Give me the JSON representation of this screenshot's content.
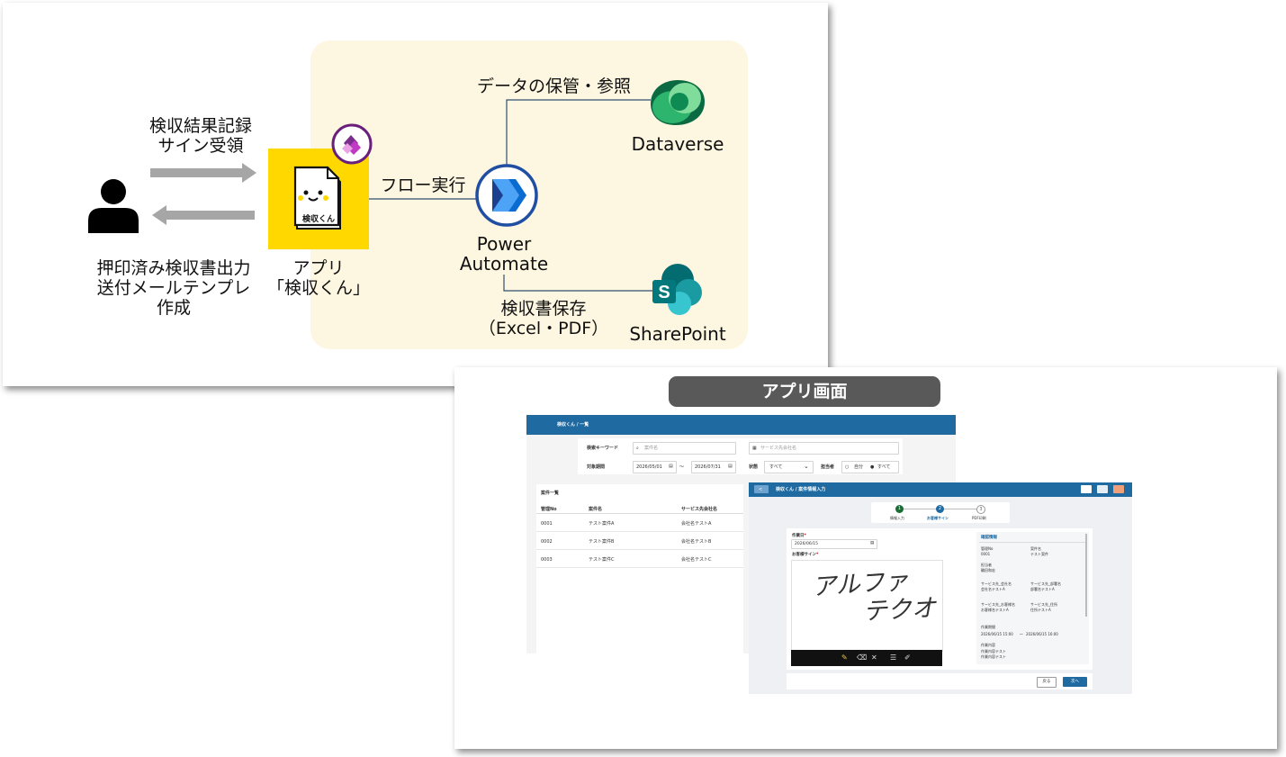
{
  "diagram": {
    "user_labels": {
      "input_line1": "検収結果記録",
      "input_line2": "サイン受領",
      "output_line1": "押印済み検収書出力",
      "output_line2": "送付メールテンプレ",
      "output_line3": "作成"
    },
    "app": {
      "icon_text": "検収くん",
      "label_line1": "アプリ",
      "label_line2": "「検収くん」"
    },
    "flow_label": "フロー実行",
    "power_automate": {
      "line1": "Power",
      "line2": "Automate"
    },
    "dataverse": {
      "label": "Dataverse",
      "edge_label": "データの保管・参照"
    },
    "sharepoint": {
      "label": "SharePoint",
      "edge_line1": "検収書保存",
      "edge_line2": "（Excel・PDF）"
    },
    "colors": {
      "container": "#fdf6e0",
      "arrow": "#a6a6a6",
      "app_bg": "#ffd800",
      "connector": "#2f4f6f"
    }
  },
  "app_screen": {
    "title": "アプリ画面",
    "list_screen": {
      "breadcrumb": "検収くん  /  一覧",
      "search_keyword_label": "検索キーワード",
      "keyword_placeholder": "案件名",
      "company_placeholder": "サービス先会社名",
      "period_label": "対象期間",
      "date_from": "2026/05/01",
      "tilde": "〜",
      "date_to": "2026/07/31",
      "status_label": "状態",
      "status_value": "すべて",
      "owner_label": "担当者",
      "owner_option_self": "自分",
      "owner_option_all": "すべて",
      "table_title": "案件一覧",
      "columns": [
        "管理No",
        "案件名",
        "サービス先会社名"
      ],
      "rows": [
        [
          "0001",
          "テスト案件A",
          "会社名テストA"
        ],
        [
          "0002",
          "テスト案件B",
          "会社名テストB"
        ],
        [
          "0003",
          "テスト案件C",
          "会社名テストC"
        ]
      ]
    },
    "detail_screen": {
      "back_label": "<",
      "breadcrumb": "検収くん  /  案件情報入力",
      "steps": [
        {
          "num": "1",
          "label": "情報入力"
        },
        {
          "num": "2",
          "label": "お客様サイン"
        },
        {
          "num": "3",
          "label": "PDF印刷"
        }
      ],
      "date_label": "作業日",
      "required_mark": "*",
      "date_value": "2026/06/15",
      "sign_label": "お客様サイン",
      "signature_line1": "アルファ",
      "signature_line2": "テクオ",
      "confirm_title": "確認情報",
      "info": [
        {
          "label": "管理No",
          "value": "0001"
        },
        {
          "label": "案件名",
          "value": "テスト案件"
        },
        {
          "label": "担当者",
          "value": "輪田和宏"
        },
        {
          "label": "サービス先_会社名",
          "value": "会社名テストA"
        },
        {
          "label": "サービス先_部署名",
          "value": "部署名テストA"
        },
        {
          "label": "サービス先_お客様名",
          "value": "お客様名テストA"
        },
        {
          "label": "サービス先_住所",
          "value": "住所テストA"
        }
      ],
      "work_time_label": "作業期間",
      "work_time_from": "2026/06/15 15:00",
      "work_time_to": "2026/06/15 16:00",
      "work_content_label": "作業内容",
      "work_content_line1": "作業内容テスト",
      "work_content_line2": "作業内容テスト",
      "back_button": "戻る",
      "next_button": "次へ"
    }
  }
}
